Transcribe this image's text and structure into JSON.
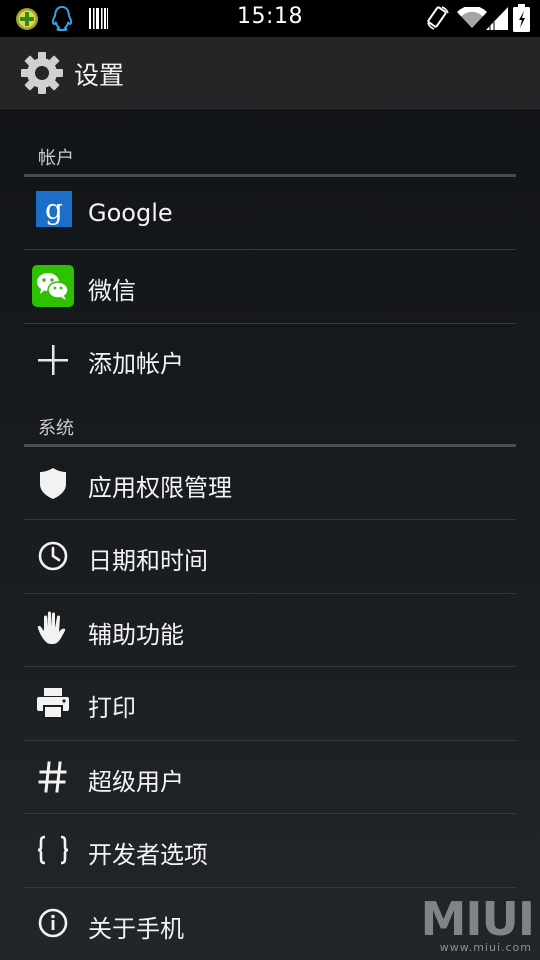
{
  "status_bar": {
    "time": "15:18",
    "left_icons": [
      "app-notification-icon",
      "qq-icon",
      "barcode-icon"
    ],
    "right_icons": [
      "rotation-lock-icon",
      "wifi-icon",
      "signal-icon",
      "battery-icon"
    ]
  },
  "action_bar": {
    "title": "设置",
    "icon": "gear-icon"
  },
  "sections": [
    {
      "header": "帐户",
      "items": [
        {
          "label": "Google",
          "icon": "google-icon"
        },
        {
          "label": "微信",
          "icon": "wechat-icon"
        },
        {
          "label": "添加帐户",
          "icon": "plus-icon"
        }
      ]
    },
    {
      "header": "系统",
      "items": [
        {
          "label": "应用权限管理",
          "icon": "shield-icon"
        },
        {
          "label": "日期和时间",
          "icon": "clock-icon"
        },
        {
          "label": "辅助功能",
          "icon": "hand-icon"
        },
        {
          "label": "打印",
          "icon": "printer-icon"
        },
        {
          "label": "超级用户",
          "icon": "hash-icon"
        },
        {
          "label": "开发者选项",
          "icon": "braces-icon"
        },
        {
          "label": "关于手机",
          "icon": "info-icon"
        }
      ]
    }
  ],
  "watermark": {
    "brand": "MIUI",
    "url": "www.miui.com"
  },
  "colors": {
    "google_blue": "#1c6fc9",
    "wechat_green": "#2dc100",
    "divider": "#34383b",
    "section_line": "#4a4d50"
  }
}
